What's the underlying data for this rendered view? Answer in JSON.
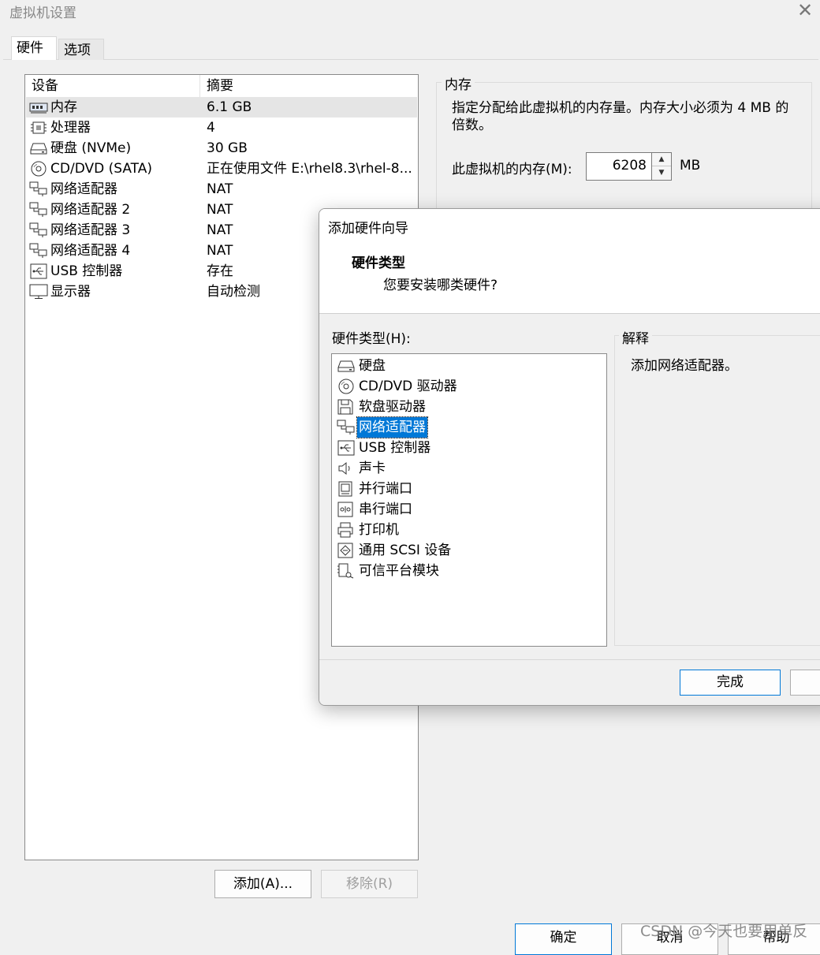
{
  "window": {
    "title": "虚拟机设置"
  },
  "tabs": [
    {
      "label": "硬件"
    },
    {
      "label": "选项"
    }
  ],
  "device_list": {
    "headers": {
      "device": "设备",
      "summary": "摘要"
    },
    "rows": [
      {
        "icon": "memory-icon",
        "name": "内存",
        "summary": "6.1 GB"
      },
      {
        "icon": "processor-icon",
        "name": "处理器",
        "summary": "4"
      },
      {
        "icon": "harddisk-icon",
        "name": "硬盘 (NVMe)",
        "summary": "30 GB"
      },
      {
        "icon": "cd-dvd-icon",
        "name": "CD/DVD (SATA)",
        "summary": "正在使用文件 E:\\rhel8.3\\rhel-8..."
      },
      {
        "icon": "network-adapter-icon",
        "name": "网络适配器",
        "summary": "NAT"
      },
      {
        "icon": "network-adapter-icon",
        "name": "网络适配器 2",
        "summary": "NAT"
      },
      {
        "icon": "network-adapter-icon",
        "name": "网络适配器 3",
        "summary": "NAT"
      },
      {
        "icon": "network-adapter-icon",
        "name": "网络适配器 4",
        "summary": "NAT"
      },
      {
        "icon": "usb-icon",
        "name": "USB 控制器",
        "summary": "存在"
      },
      {
        "icon": "display-icon",
        "name": "显示器",
        "summary": "自动检测"
      }
    ],
    "add_button": "添加(A)...",
    "remove_button": "移除(R)"
  },
  "memory": {
    "group_label": "内存",
    "description": "指定分配给此虚拟机的内存量。内存大小必须为 4 MB 的倍数。",
    "field_label": "此虚拟机的内存(M):",
    "value": "6208",
    "unit": "MB"
  },
  "wizard": {
    "title": "添加硬件向导",
    "heading": "硬件类型",
    "subheading": "您要安装哪类硬件?",
    "list_label": "硬件类型(H):",
    "items": [
      {
        "icon": "harddisk-icon",
        "label": "硬盘"
      },
      {
        "icon": "cd-dvd-icon",
        "label": "CD/DVD 驱动器"
      },
      {
        "icon": "floppy-icon",
        "label": "软盘驱动器"
      },
      {
        "icon": "network-adapter-icon",
        "label": "网络适配器"
      },
      {
        "icon": "usb-icon",
        "label": "USB 控制器"
      },
      {
        "icon": "sound-icon",
        "label": "声卡"
      },
      {
        "icon": "parallel-port-icon",
        "label": "并行端口"
      },
      {
        "icon": "serial-port-icon",
        "label": "串行端口"
      },
      {
        "icon": "printer-icon",
        "label": "打印机"
      },
      {
        "icon": "scsi-icon",
        "label": "通用 SCSI 设备"
      },
      {
        "icon": "tpm-icon",
        "label": "可信平台模块"
      }
    ],
    "selected_index": 3,
    "explain_label": "解释",
    "explain_text": "添加网络适配器。",
    "finish_button": "完成"
  },
  "buttons": {
    "ok": "确定",
    "cancel": "取消",
    "help": "帮助"
  },
  "watermark": "CSDN @今天也要用单反",
  "colors": {
    "selection": "#0078d7",
    "background": "#f0f0f0"
  }
}
